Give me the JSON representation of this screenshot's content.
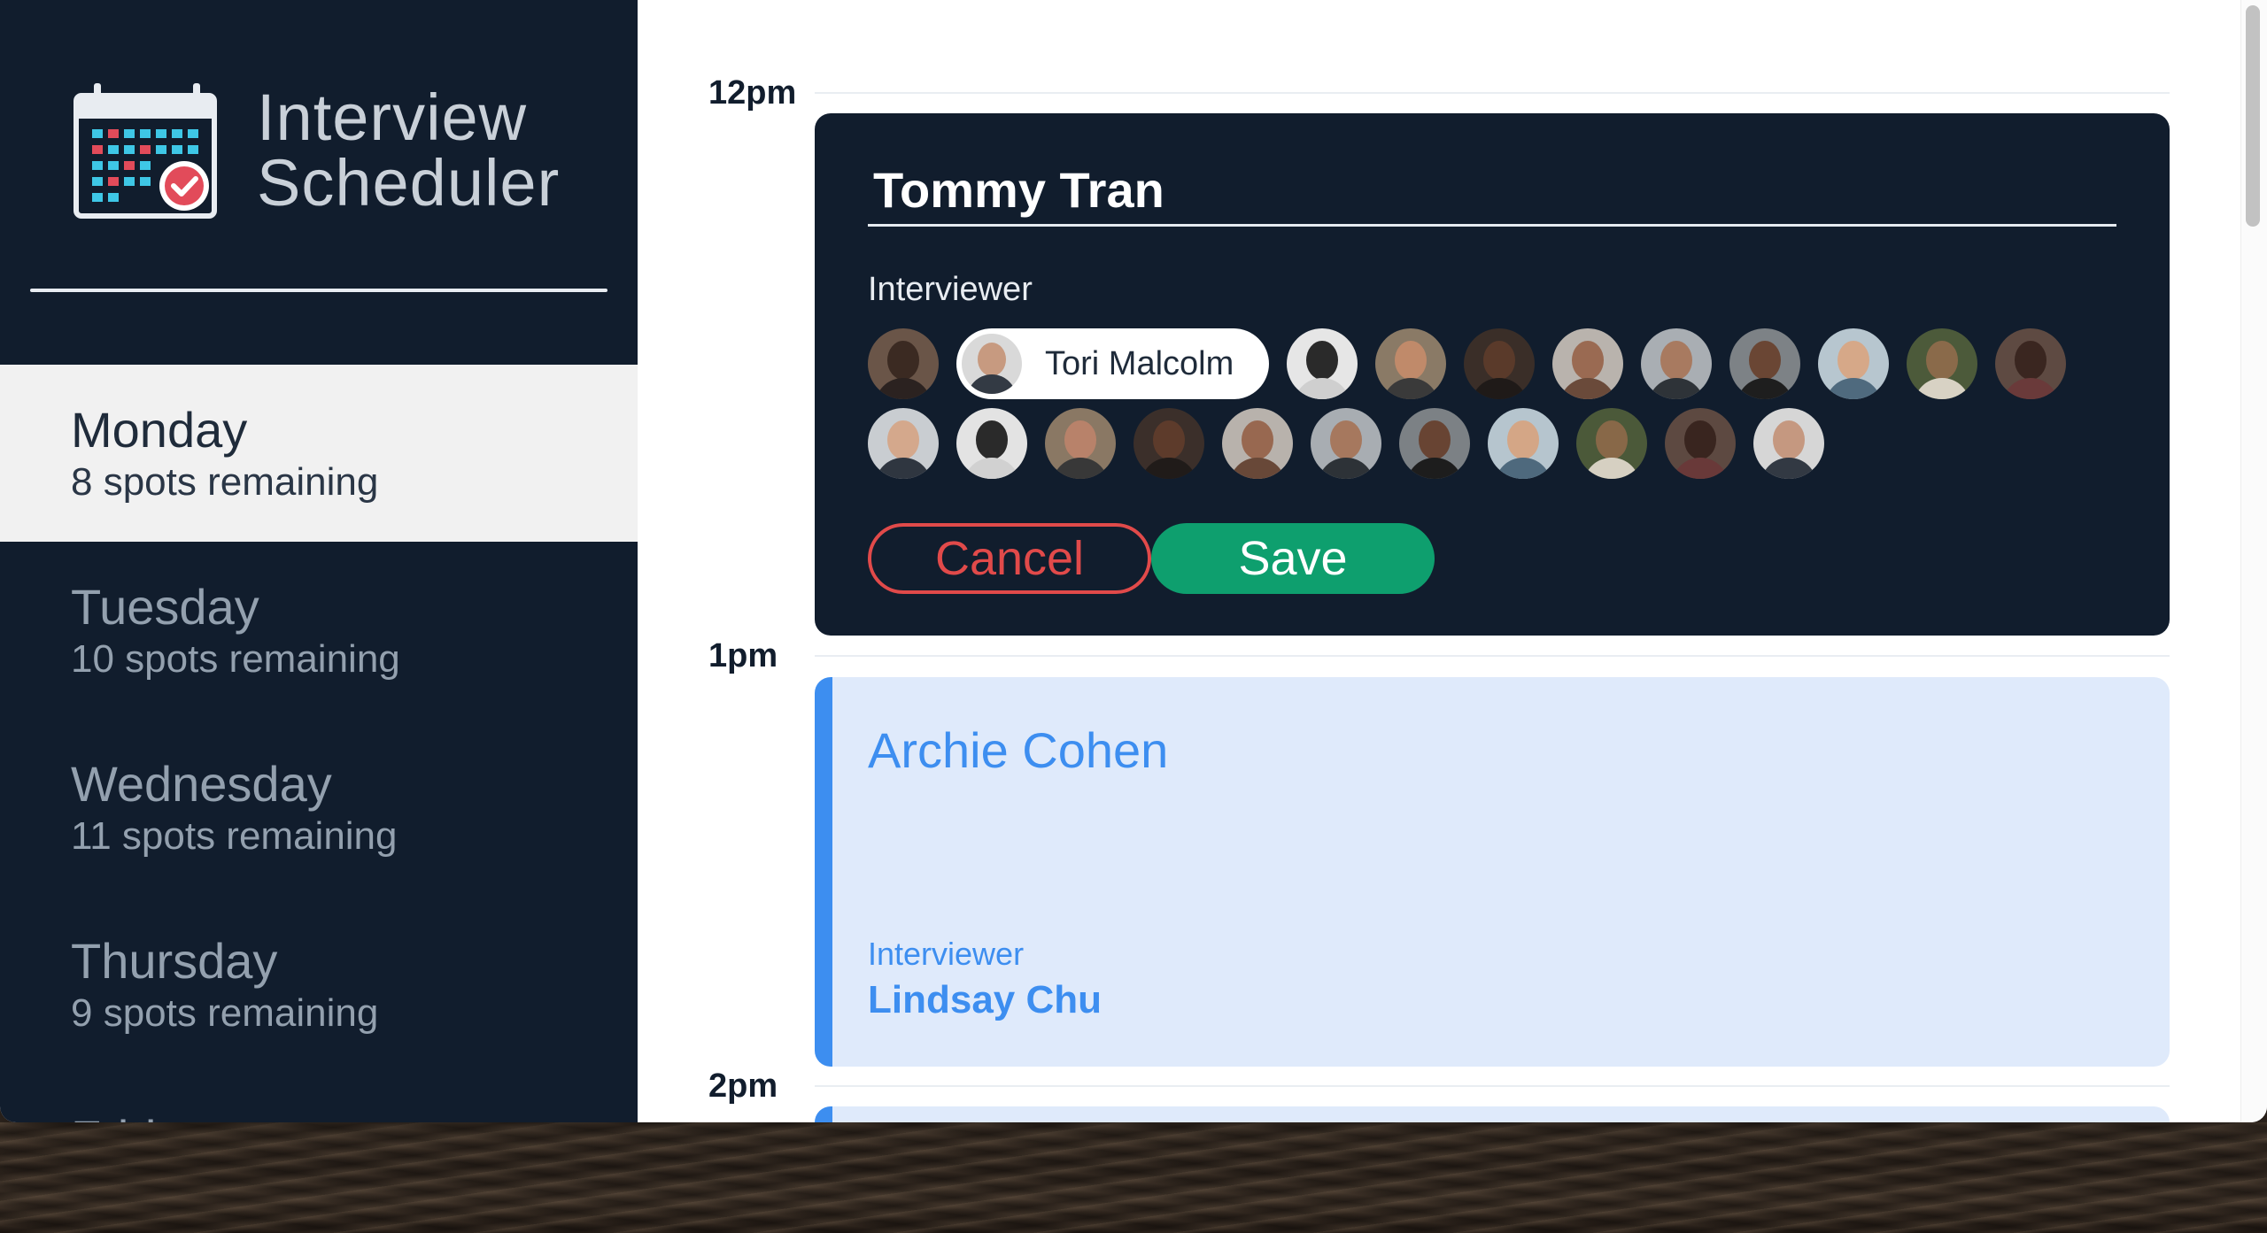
{
  "app": {
    "title_line1": "Interview",
    "title_line2": "Scheduler"
  },
  "sidebar": {
    "days": [
      {
        "name": "Monday",
        "spots": "8 spots remaining",
        "selected": true
      },
      {
        "name": "Tuesday",
        "spots": "10 spots remaining",
        "selected": false
      },
      {
        "name": "Wednesday",
        "spots": "11 spots remaining",
        "selected": false
      },
      {
        "name": "Thursday",
        "spots": "9 spots remaining",
        "selected": false
      },
      {
        "name": "Friday",
        "spots": "",
        "selected": false
      }
    ]
  },
  "schedule": {
    "hours": [
      "12pm",
      "1pm",
      "2pm"
    ],
    "form": {
      "student_value": "Tommy Tran",
      "interviewer_label": "Interviewer",
      "selected_interviewer": "Tori Malcolm",
      "cancel_label": "Cancel",
      "save_label": "Save"
    },
    "appointment": {
      "student": "Archie Cohen",
      "interviewer_label": "Interviewer",
      "interviewer": "Lindsay Chu"
    }
  },
  "colors": {
    "sidebar_bg": "#111d2d",
    "selected_day_bg": "#f1f1f1",
    "accent_blue": "#3d8ef0",
    "appointment_bg": "#dfeafb",
    "save_green": "#0e9f6e",
    "cancel_red": "#e14a4a"
  },
  "icons": {
    "logo": "calendar-check-icon"
  }
}
